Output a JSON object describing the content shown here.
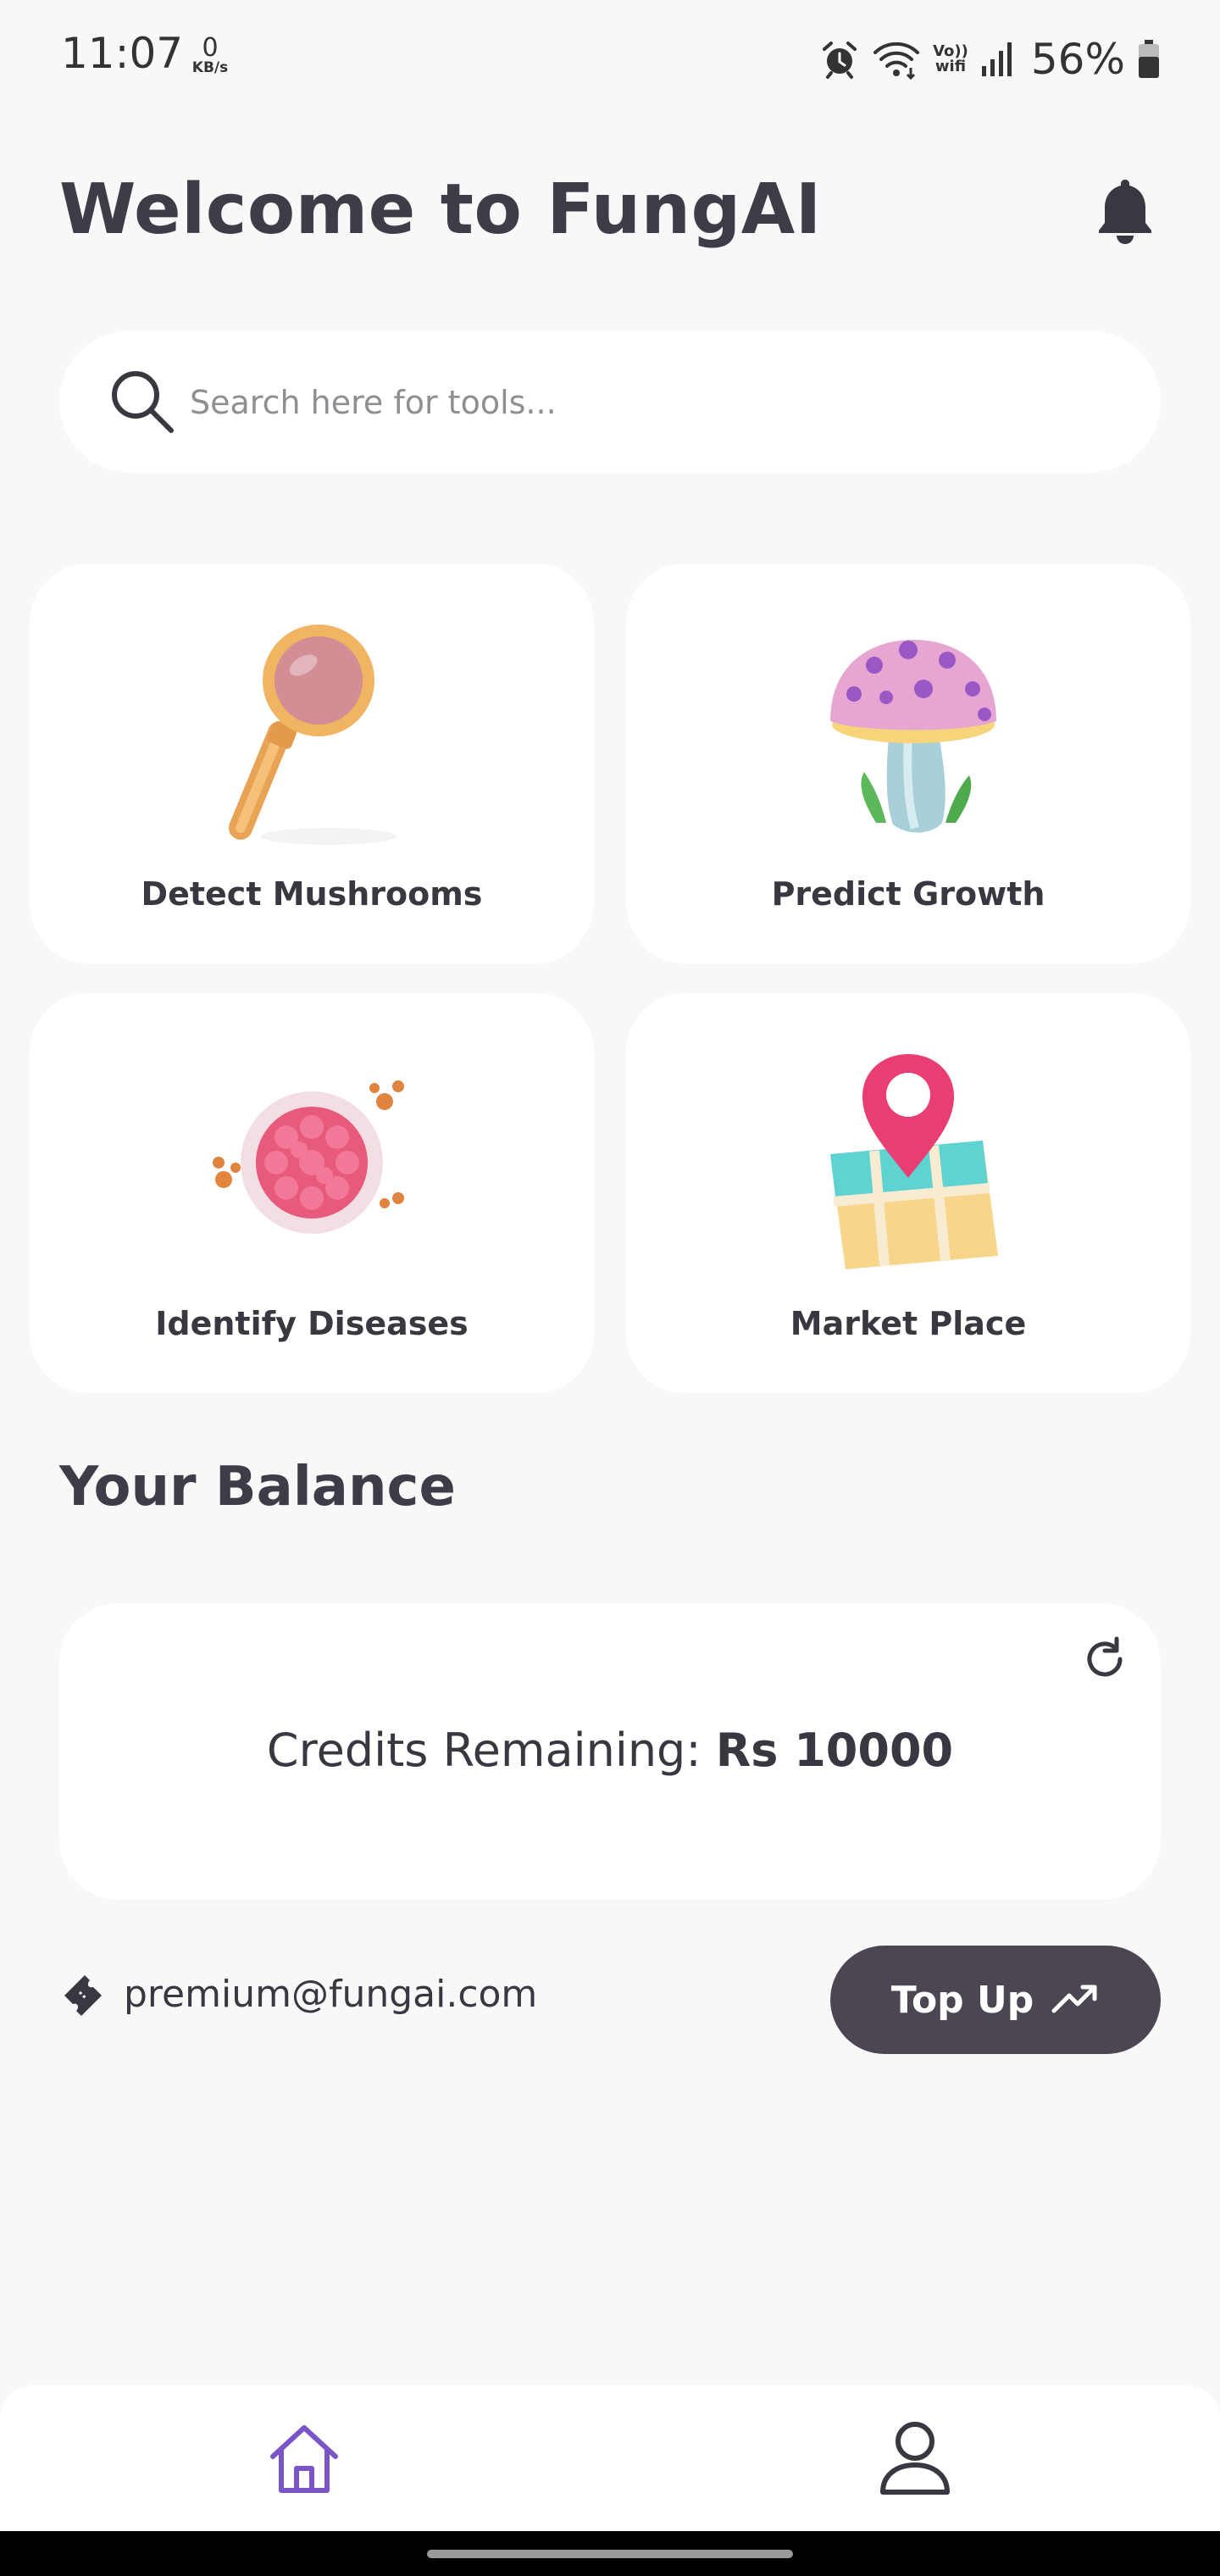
{
  "status_bar": {
    "time": "11:07",
    "net_speed_value": "0",
    "net_speed_unit": "KB/s",
    "vowifi_line1": "Vo))",
    "vowifi_line2": "wifi",
    "battery_percent": "56%",
    "icons": [
      "alarm-icon",
      "wifi-icon",
      "vowifi-icon",
      "signal-icon",
      "battery-icon"
    ]
  },
  "header": {
    "title": "Welcome to FungAI",
    "notification_icon": "bell-icon"
  },
  "search": {
    "placeholder": "Search here for tools...",
    "value": "",
    "icon": "search-icon"
  },
  "tools": [
    {
      "label": "Detect Mushrooms",
      "icon": "magnifying-glass-illustration"
    },
    {
      "label": "Predict Growth",
      "icon": "mushroom-illustration"
    },
    {
      "label": "Identify Diseases",
      "icon": "virus-illustration"
    },
    {
      "label": "Market Place",
      "icon": "map-pin-illustration"
    }
  ],
  "balance": {
    "section_title": "Your Balance",
    "credits_label": "Credits Remaining:",
    "credits_value": "Rs 10000",
    "refresh_icon": "refresh-icon"
  },
  "account": {
    "email": "premium@fungai.com",
    "icon": "ticket-icon"
  },
  "topup": {
    "label": "Top Up",
    "icon": "trending-up-icon"
  },
  "bottom_nav": {
    "items": [
      {
        "name": "home",
        "icon": "home-icon",
        "active": true,
        "color": "#7a55c8"
      },
      {
        "name": "profile",
        "icon": "profile-icon",
        "active": false,
        "color": "#3a3741"
      }
    ]
  },
  "colors": {
    "background": "#f8f8f9",
    "card": "#ffffff",
    "primary_text": "#3f3c48",
    "button": "#4b4652",
    "accent": "#7a55c8"
  }
}
